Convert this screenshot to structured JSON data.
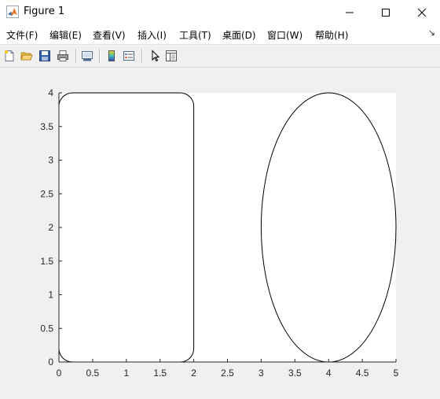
{
  "window": {
    "title": "Figure 1"
  },
  "menu": {
    "items": [
      {
        "label": "文件(F)"
      },
      {
        "label": "编辑(E)"
      },
      {
        "label": "查看(V)"
      },
      {
        "label": "插入(I)"
      },
      {
        "label": "工具(T)"
      },
      {
        "label": "桌面(D)"
      },
      {
        "label": "窗口(W)"
      },
      {
        "label": "帮助(H)"
      }
    ],
    "overflow_icon": "chevron-right-icon"
  },
  "toolbar": {
    "buttons": [
      {
        "name": "new-figure-button",
        "icon": "new-document-icon"
      },
      {
        "name": "open-file-button",
        "icon": "folder-open-icon"
      },
      {
        "name": "save-figure-button",
        "icon": "save-disk-icon"
      },
      {
        "name": "print-figure-button",
        "icon": "printer-icon"
      },
      {
        "name": "link-plot-button",
        "icon": "link-plot-icon"
      },
      {
        "name": "insert-colorbar-button",
        "icon": "colorbar-icon"
      },
      {
        "name": "insert-legend-button",
        "icon": "legend-icon"
      },
      {
        "name": "edit-plot-button",
        "icon": "pointer-arrow-icon"
      },
      {
        "name": "property-inspector-button",
        "icon": "panel-icon"
      }
    ]
  },
  "chart_data": {
    "type": "line",
    "title": "",
    "xlabel": "",
    "ylabel": "",
    "xlim": [
      0,
      5
    ],
    "ylim": [
      0,
      4
    ],
    "xticks": [
      "0",
      "0.5",
      "1",
      "1.5",
      "2",
      "2.5",
      "3",
      "3.5",
      "4",
      "4.5",
      "5"
    ],
    "yticks": [
      "0",
      "0.5",
      "1",
      "1.5",
      "2",
      "2.5",
      "3",
      "3.5",
      "4"
    ],
    "grid": false,
    "line_color": "#000000",
    "shapes": [
      {
        "kind": "rounded-rectangle",
        "x": 0,
        "y": 0,
        "width": 2,
        "height": 4,
        "curvature": [
          0.2,
          0.1
        ]
      },
      {
        "kind": "rounded-rectangle",
        "x": 3,
        "y": 0,
        "width": 2,
        "height": 4,
        "curvature": [
          1,
          1
        ]
      }
    ]
  }
}
